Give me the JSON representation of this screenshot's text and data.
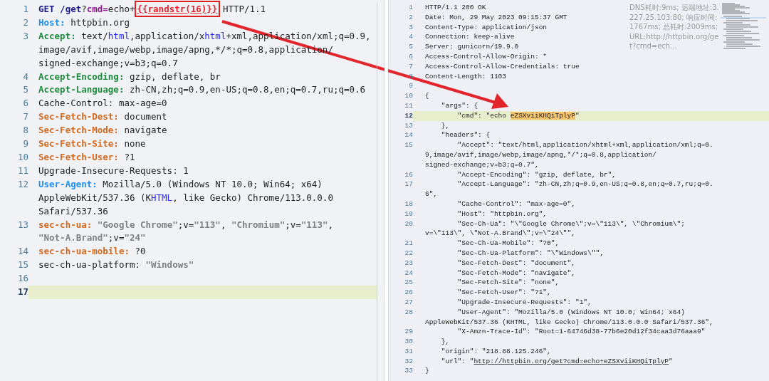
{
  "request": {
    "lines": [
      {
        "num": "1",
        "current": false,
        "rows": [
          [
            {
              "kind": "method",
              "text": "GET"
            },
            {
              "kind": "plain",
              "text": " "
            },
            {
              "kind": "path",
              "text": "/get"
            },
            {
              "kind": "plain",
              "text": "?"
            },
            {
              "kind": "param",
              "text": "cmd="
            },
            {
              "kind": "plain",
              "text": "echo+"
            },
            {
              "kind": "template",
              "text": "{{randstr(16)}}"
            },
            {
              "kind": "plain",
              "text": " HTTP/1.1"
            }
          ]
        ]
      },
      {
        "num": "2",
        "current": false,
        "rows": [
          [
            {
              "kind": "key-blue",
              "text": "Host:"
            },
            {
              "kind": "plain",
              "text": " httpbin.org"
            }
          ]
        ]
      },
      {
        "num": "3",
        "current": false,
        "rows": [
          [
            {
              "kind": "key-green",
              "text": "Accept:"
            },
            {
              "kind": "plain",
              "text": " text/"
            },
            {
              "kind": "mime",
              "text": "html"
            },
            {
              "kind": "plain",
              "text": ",application/x"
            },
            {
              "kind": "mime",
              "text": "html"
            },
            {
              "kind": "plain",
              "text": "+xml,application/xml;q=0.9,"
            }
          ],
          [
            {
              "kind": "plain",
              "text": "image/avif,image/webp,image/apng,*/*;q=0.8,application/"
            }
          ],
          [
            {
              "kind": "plain",
              "text": "signed-exchange;v=b3;q=0.7"
            }
          ]
        ]
      },
      {
        "num": "4",
        "current": false,
        "rows": [
          [
            {
              "kind": "key-green",
              "text": "Accept-Encoding:"
            },
            {
              "kind": "plain",
              "text": " gzip, deflate, br"
            }
          ]
        ]
      },
      {
        "num": "5",
        "current": false,
        "rows": [
          [
            {
              "kind": "key-green",
              "text": "Accept-Language:"
            },
            {
              "kind": "plain",
              "text": " zh-CN,zh;q=0.9,en-US;q=0.8,en;q=0.7,ru;q=0.6"
            }
          ]
        ]
      },
      {
        "num": "6",
        "current": false,
        "rows": [
          [
            {
              "kind": "plain",
              "text": "Cache-Control: max-age=0"
            }
          ]
        ]
      },
      {
        "num": "7",
        "current": false,
        "rows": [
          [
            {
              "kind": "key-orange",
              "text": "Sec-Fetch-Dest:"
            },
            {
              "kind": "plain",
              "text": " document"
            }
          ]
        ]
      },
      {
        "num": "8",
        "current": false,
        "rows": [
          [
            {
              "kind": "key-orange",
              "text": "Sec-Fetch-Mode:"
            },
            {
              "kind": "plain",
              "text": " navigate"
            }
          ]
        ]
      },
      {
        "num": "9",
        "current": false,
        "rows": [
          [
            {
              "kind": "key-orange",
              "text": "Sec-Fetch-Site:"
            },
            {
              "kind": "plain",
              "text": " none"
            }
          ]
        ]
      },
      {
        "num": "10",
        "current": false,
        "rows": [
          [
            {
              "kind": "key-orange",
              "text": "Sec-Fetch-User:"
            },
            {
              "kind": "plain",
              "text": " ?1"
            }
          ]
        ]
      },
      {
        "num": "11",
        "current": false,
        "rows": [
          [
            {
              "kind": "plain",
              "text": "Upgrade-Insecure-Requests: 1"
            }
          ]
        ]
      },
      {
        "num": "12",
        "current": false,
        "rows": [
          [
            {
              "kind": "key-blue",
              "text": "User-Agent:"
            },
            {
              "kind": "plain",
              "text": " Mozilla/5.0 (Windows NT 10.0; Win64; x64)"
            }
          ],
          [
            {
              "kind": "plain",
              "text": "AppleWebKit/537.36 (K"
            },
            {
              "kind": "mime",
              "text": "HTML"
            },
            {
              "kind": "plain",
              "text": ", like Gecko) Chrome/113.0.0.0"
            }
          ],
          [
            {
              "kind": "plain",
              "text": "Safari/537.36"
            }
          ]
        ]
      },
      {
        "num": "13",
        "current": false,
        "rows": [
          [
            {
              "kind": "key-orange",
              "text": "sec-ch-ua:"
            },
            {
              "kind": "plain",
              "text": " "
            },
            {
              "kind": "str",
              "text": "\"Google Chrome\""
            },
            {
              "kind": "plain",
              "text": ";v="
            },
            {
              "kind": "str",
              "text": "\"113\""
            },
            {
              "kind": "plain",
              "text": ", "
            },
            {
              "kind": "str",
              "text": "\"Chromium\""
            },
            {
              "kind": "plain",
              "text": ";v="
            },
            {
              "kind": "str",
              "text": "\"113\""
            },
            {
              "kind": "plain",
              "text": ","
            }
          ],
          [
            {
              "kind": "str",
              "text": "\"Not-A.Brand\""
            },
            {
              "kind": "plain",
              "text": ";v="
            },
            {
              "kind": "str",
              "text": "\"24\""
            }
          ]
        ]
      },
      {
        "num": "14",
        "current": false,
        "rows": [
          [
            {
              "kind": "key-orange",
              "text": "sec-ch-ua-mobile:"
            },
            {
              "kind": "plain",
              "text": " ?0"
            }
          ]
        ]
      },
      {
        "num": "15",
        "current": false,
        "rows": [
          [
            {
              "kind": "plain",
              "text": "sec-ch-ua-platform: "
            },
            {
              "kind": "str",
              "text": "\"Windows\""
            }
          ]
        ]
      },
      {
        "num": "16",
        "current": false,
        "rows": [
          []
        ]
      },
      {
        "num": "17",
        "current": true,
        "rows": [
          []
        ]
      }
    ]
  },
  "response": {
    "info": "DNS耗时:9ms; 远端地址:3.227.25.103:80; 响应时间:1767ms; 总耗时:2009ms; URL:http://httpbin.org/get?cmd=ech...",
    "lines": [
      {
        "num": "1",
        "current": false,
        "rows": [
          [
            {
              "kind": "plain",
              "text": "HTTP/1.1 200 OK"
            }
          ]
        ]
      },
      {
        "num": "2",
        "current": false,
        "rows": [
          [
            {
              "kind": "plain",
              "text": "Date: Mon, 29 May 2023 09:15:37 GMT"
            }
          ]
        ]
      },
      {
        "num": "3",
        "current": false,
        "rows": [
          [
            {
              "kind": "plain",
              "text": "Content-Type: application/json"
            }
          ]
        ]
      },
      {
        "num": "4",
        "current": false,
        "rows": [
          [
            {
              "kind": "plain",
              "text": "Connection: keep-alive"
            }
          ]
        ]
      },
      {
        "num": "5",
        "current": false,
        "rows": [
          [
            {
              "kind": "plain",
              "text": "Server: gunicorn/19.9.0"
            }
          ]
        ]
      },
      {
        "num": "6",
        "current": false,
        "rows": [
          [
            {
              "kind": "plain",
              "text": "Access-Control-Allow-Origin: *"
            }
          ]
        ]
      },
      {
        "num": "7",
        "current": false,
        "rows": [
          [
            {
              "kind": "plain",
              "text": "Access-Control-Allow-Credentials: true"
            }
          ]
        ]
      },
      {
        "num": "8",
        "current": false,
        "rows": [
          [
            {
              "kind": "plain",
              "text": "Content-Length: 1103"
            }
          ]
        ]
      },
      {
        "num": "9",
        "current": false,
        "rows": [
          []
        ]
      },
      {
        "num": "10",
        "current": false,
        "rows": [
          [
            {
              "kind": "plain",
              "text": "{"
            }
          ]
        ]
      },
      {
        "num": "11",
        "current": false,
        "rows": [
          [
            {
              "kind": "plain",
              "text": "    \"args\": {"
            }
          ]
        ]
      },
      {
        "num": "12",
        "current": true,
        "rows": [
          [
            {
              "kind": "plain",
              "text": "        \"cmd\": \"echo "
            },
            {
              "kind": "match",
              "text": "eZSXviiKHQiTplyP"
            },
            {
              "kind": "plain",
              "text": "\""
            }
          ]
        ]
      },
      {
        "num": "13",
        "current": false,
        "rows": [
          [
            {
              "kind": "plain",
              "text": "    },"
            }
          ]
        ]
      },
      {
        "num": "14",
        "current": false,
        "rows": [
          [
            {
              "kind": "plain",
              "text": "    \"headers\": {"
            }
          ]
        ]
      },
      {
        "num": "15",
        "current": false,
        "rows": [
          [
            {
              "kind": "plain",
              "text": "        \"Accept\": \"text/html,application/xhtml+xml,application/xml;q=0."
            }
          ],
          [
            {
              "kind": "plain",
              "text": "9,image/avif,image/webp,image/apng,*/*;q=0.8,application/"
            }
          ],
          [
            {
              "kind": "plain",
              "text": "signed-exchange;v=b3;q=0.7\","
            }
          ]
        ]
      },
      {
        "num": "16",
        "current": false,
        "rows": [
          [
            {
              "kind": "plain",
              "text": "        \"Accept-Encoding\": \"gzip, deflate, br\","
            }
          ]
        ]
      },
      {
        "num": "17",
        "current": false,
        "rows": [
          [
            {
              "kind": "plain",
              "text": "        \"Accept-Language\": \"zh-CN,zh;q=0.9,en-US;q=0.8,en;q=0.7,ru;q=0."
            }
          ],
          [
            {
              "kind": "plain",
              "text": "6\","
            }
          ]
        ]
      },
      {
        "num": "18",
        "current": false,
        "rows": [
          [
            {
              "kind": "plain",
              "text": "        \"Cache-Control\": \"max-age=0\","
            }
          ]
        ]
      },
      {
        "num": "19",
        "current": false,
        "rows": [
          [
            {
              "kind": "plain",
              "text": "        \"Host\": \"httpbin.org\","
            }
          ]
        ]
      },
      {
        "num": "20",
        "current": false,
        "rows": [
          [
            {
              "kind": "plain",
              "text": "        \"Sec-Ch-Ua\": \"\\\"Google Chrome\\\";v=\\\"113\\\", \\\"Chromium\\\";"
            }
          ],
          [
            {
              "kind": "plain",
              "text": "v=\\\"113\\\", \\\"Not-A.Brand\\\";v=\\\"24\\\"\","
            }
          ]
        ]
      },
      {
        "num": "21",
        "current": false,
        "rows": [
          [
            {
              "kind": "plain",
              "text": "        \"Sec-Ch-Ua-Mobile\": \"?0\","
            }
          ]
        ]
      },
      {
        "num": "22",
        "current": false,
        "rows": [
          [
            {
              "kind": "plain",
              "text": "        \"Sec-Ch-Ua-Platform\": \"\\\"Windows\\\"\","
            }
          ]
        ]
      },
      {
        "num": "23",
        "current": false,
        "rows": [
          [
            {
              "kind": "plain",
              "text": "        \"Sec-Fetch-Dest\": \"document\","
            }
          ]
        ]
      },
      {
        "num": "24",
        "current": false,
        "rows": [
          [
            {
              "kind": "plain",
              "text": "        \"Sec-Fetch-Mode\": \"navigate\","
            }
          ]
        ]
      },
      {
        "num": "25",
        "current": false,
        "rows": [
          [
            {
              "kind": "plain",
              "text": "        \"Sec-Fetch-Site\": \"none\","
            }
          ]
        ]
      },
      {
        "num": "26",
        "current": false,
        "rows": [
          [
            {
              "kind": "plain",
              "text": "        \"Sec-Fetch-User\": \"?1\","
            }
          ]
        ]
      },
      {
        "num": "27",
        "current": false,
        "rows": [
          [
            {
              "kind": "plain",
              "text": "        \"Upgrade-Insecure-Requests\": \"1\","
            }
          ]
        ]
      },
      {
        "num": "28",
        "current": false,
        "rows": [
          [
            {
              "kind": "plain",
              "text": "        \"User-Agent\": \"Mozilla/5.0 (Windows NT 10.0; Win64; x64)"
            }
          ],
          [
            {
              "kind": "plain",
              "text": "AppleWebKit/537.36 (KHTML, like Gecko) Chrome/113.0.0.0 Safari/537.36\","
            }
          ]
        ]
      },
      {
        "num": "29",
        "current": false,
        "rows": [
          [
            {
              "kind": "plain",
              "text": "        \"X-Amzn-Trace-Id\": \"Root=1-64746d38-77b6e20d12f34caa3d76aaa9\""
            }
          ]
        ]
      },
      {
        "num": "30",
        "current": false,
        "rows": [
          [
            {
              "kind": "plain",
              "text": "    },"
            }
          ]
        ]
      },
      {
        "num": "31",
        "current": false,
        "rows": [
          [
            {
              "kind": "plain",
              "text": "    \"origin\": \"218.88.125.246\","
            }
          ]
        ]
      },
      {
        "num": "32",
        "current": false,
        "rows": [
          [
            {
              "kind": "plain",
              "text": "    \"url\": \""
            },
            {
              "kind": "link",
              "text": "http://httpbin.org/get?cmd=echo+eZSXviiKHQiTplyP"
            },
            {
              "kind": "plain",
              "text": "\""
            }
          ]
        ]
      },
      {
        "num": "33",
        "current": false,
        "rows": [
          [
            {
              "kind": "plain",
              "text": "}"
            }
          ]
        ]
      }
    ]
  }
}
